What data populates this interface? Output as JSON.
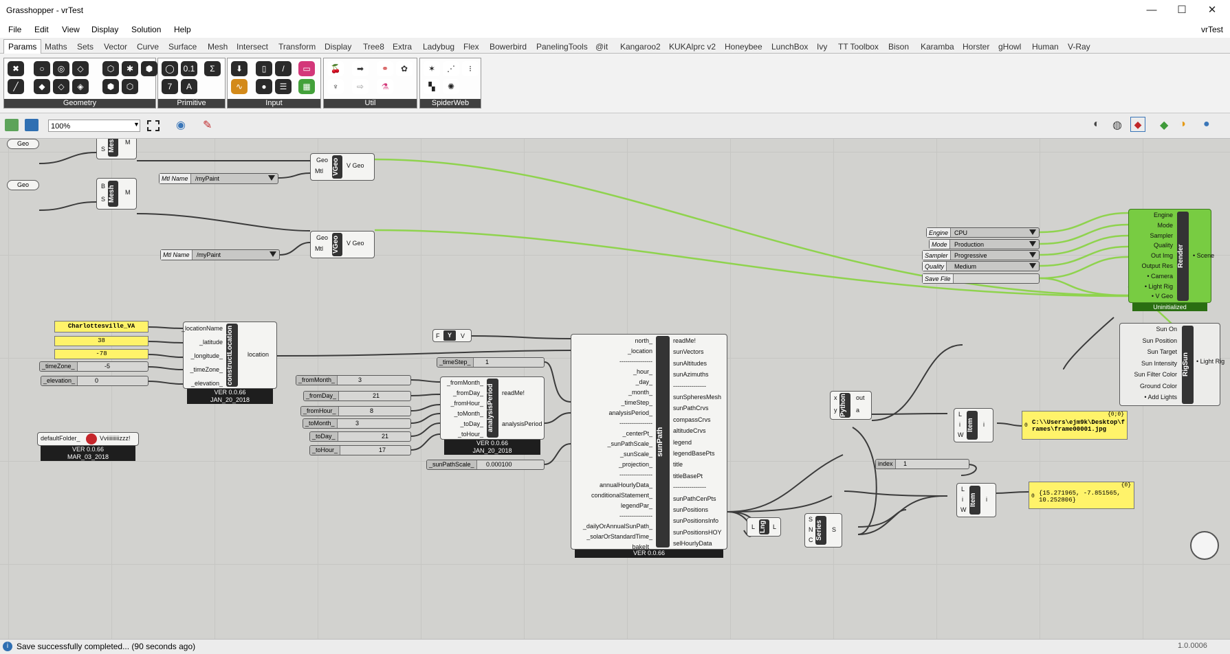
{
  "window": {
    "title": "Grasshopper - vrTest",
    "minimize": "—",
    "maximize": "☐",
    "close": "✕",
    "doc_name": "vrTest"
  },
  "menu": [
    "File",
    "Edit",
    "View",
    "Display",
    "Solution",
    "Help"
  ],
  "tabs": [
    "Params",
    "Maths",
    "Sets",
    "Vector",
    "Curve",
    "Surface",
    "Mesh",
    "Intersect",
    "Transform",
    "Display",
    "Tree8",
    "Extra",
    "Ladybug",
    "Flex",
    "Bowerbird",
    "PanelingTools",
    "@it",
    "Kangaroo2",
    "KUKAlprc v2",
    "Honeybee",
    "LunchBox",
    "Ivy",
    "TT Toolbox",
    "Bison",
    "Karamba",
    "Horster",
    "gHowl",
    "Human",
    "V-Ray"
  ],
  "ribbon_groups": [
    "Geometry",
    "Primitive",
    "Input",
    "Util",
    "SpiderWeb"
  ],
  "toolbar": {
    "zoom": "100%"
  },
  "status": {
    "message": "Save successfully completed... (90 seconds ago)",
    "version": "1.0.0006"
  },
  "canvas": {
    "geo1": "Geo",
    "geo2": "Geo",
    "mesh": {
      "title": "Mesh",
      "in1": "B",
      "in2": "S",
      "out": "M"
    },
    "vgeo": {
      "title": "VGeo",
      "in1": "Geo",
      "in2": "Mtl",
      "out": "V Geo"
    },
    "mtl": {
      "key": "Mtl Name",
      "value": "/myPaint"
    },
    "city": "Charlottesville_VA",
    "lat": "38",
    "lon": "-78",
    "tz": {
      "key": "_timeZone_",
      "value": "-5"
    },
    "elev": {
      "key": "_elevation_",
      "value": "0"
    },
    "construct": {
      "title": "constructLocation",
      "inputs": [
        "_locationName",
        "_latitude",
        "_longitude_",
        "_timeZone_",
        "_elevation_"
      ],
      "output": "location",
      "ver": "VER 0.0.66",
      "date": "JAN_20_2018"
    },
    "folder": {
      "in": "defaultFolder_",
      "out": "Vviiiiiiiiizzz!",
      "ver": "VER 0.0.66",
      "date": "MAR_03_2018"
    },
    "toggle": {
      "left": "F",
      "mid": "Y",
      "right": "V"
    },
    "timestep": {
      "key": "_timeStep_",
      "value": "1"
    },
    "sliders": [
      {
        "key": "_fromMonth_",
        "value": "3"
      },
      {
        "key": "_fromDay_",
        "value": "21"
      },
      {
        "key": "_fromHour_",
        "value": "8"
      },
      {
        "key": "_toMonth_",
        "value": "3"
      },
      {
        "key": "_toDay_",
        "value": "21"
      },
      {
        "key": "_toHour_",
        "value": "17"
      }
    ],
    "analysis": {
      "title": "analysisPeriod",
      "inputs": [
        "_fromMonth_",
        "_fromDay_",
        "_fromHour_",
        "_toMonth_",
        "_toDay_",
        "_toHour_"
      ],
      "outputs": [
        "readMe!",
        "analysisPeriod"
      ],
      "ver": "VER 0.0.66",
      "date": "JAN_20_2018"
    },
    "scale": {
      "key": "_sunPathScale_",
      "value": "0.000100"
    },
    "sunpath": {
      "title": "sunPath",
      "inputs": [
        "north_",
        "_location",
        "----------------",
        "_hour_",
        "_day_",
        "_month_",
        "_timeStep_",
        "analysisPeriod_",
        "----------------",
        "_centerPt_",
        "_sunPathScale_",
        "_sunScale_",
        "_projection_",
        "----------------",
        "annualHourlyData_",
        "conditionalStatement_",
        "legendPar_",
        "----------------",
        "_dailyOrAnnualSunPath_",
        "_solarOrStandardTime_",
        "bakeIt_"
      ],
      "outputs": [
        "readMe!",
        "sunVectors",
        "sunAltitudes",
        "sunAzimuths",
        "----------------",
        "sunSpheresMesh",
        "sunPathCrvs",
        "compassCrvs",
        "altitudeCrvs",
        "legend",
        "legendBasePts",
        "title",
        "titleBasePt",
        "----------------",
        "sunPathCenPts",
        "sunPositions",
        "sunPositionsInfo",
        "sunPositionsHOY",
        "selHourlyData"
      ],
      "ver": "VER 0.0.66"
    },
    "python": {
      "title": "Python",
      "in1": "x",
      "in2": "y",
      "out1": "out",
      "out2": "a"
    },
    "item": {
      "title": "Item",
      "inputs": [
        "L",
        "i",
        "W"
      ],
      "out": "i"
    },
    "index": {
      "key": "index",
      "value": "1"
    },
    "panel1": {
      "header": "{0;0}",
      "idx": "0",
      "text": "C:\\\\Users\\ejm9k\\Desktop\\frames\\frame00001.jpg"
    },
    "panel2": {
      "header": "{0}",
      "idx": "0",
      "text": "{15.271965, -7.851565, 10.252806}"
    },
    "lng": {
      "title": "Lng",
      "in": "L",
      "out": "L"
    },
    "series": {
      "title": "Series",
      "inputs": [
        "S",
        "N",
        "C"
      ],
      "out": "S"
    },
    "engine_lists": [
      {
        "key": "Engine",
        "value": "CPU"
      },
      {
        "key": "Mode",
        "value": "Production"
      },
      {
        "key": "Sampler",
        "value": "Progressive"
      },
      {
        "key": "Quality",
        "value": "Medium"
      }
    ],
    "savefile": {
      "key": "Save File",
      "value": ""
    },
    "render": {
      "title": "Render",
      "inputs": [
        "Engine",
        "Mode",
        "Sampler",
        "Quality",
        "Out Img",
        "Output Res",
        "• Camera",
        "• Light Rig",
        "• V Geo"
      ],
      "out": "• Scene",
      "status": "Uninitialized"
    },
    "rigsun": {
      "title": "RigSun",
      "inputs": [
        "Sun On",
        "Sun Position",
        "Sun Target",
        "Sun Intensity",
        "Sun Filter Color",
        "Ground Color",
        "• Add Lights"
      ],
      "out": "• Light Rig"
    }
  }
}
